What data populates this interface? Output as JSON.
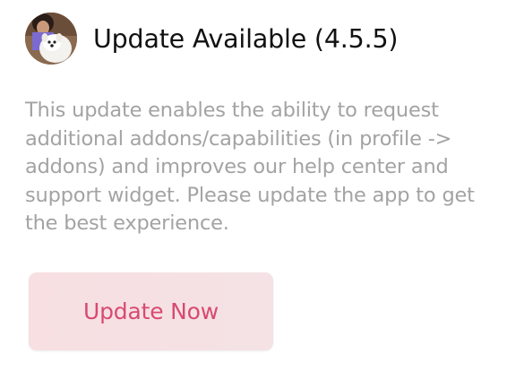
{
  "header": {
    "avatar_icon": "user-avatar-with-dog-icon",
    "title": "Update Available (4.5.5)"
  },
  "message": {
    "text": "This update enables the ability to request additional addons/capabilities (in profile -> addons) and improves our help center and support widget. Please update the app to get the best experience."
  },
  "actions": {
    "update_label": "Update Now"
  },
  "colors": {
    "title": "#111111",
    "message": "#a3a3a3",
    "button_bg": "#f6e0e3",
    "button_text": "#d84a70"
  }
}
